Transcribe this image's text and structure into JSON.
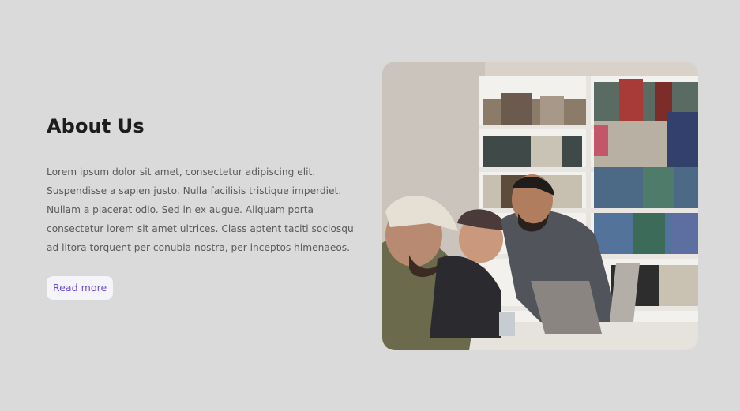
{
  "about": {
    "title": "About Us",
    "lines": [
      "Lorem ipsum dolor sit amet, consectetur adipiscing elit.",
      "Suspendisse a sapien justo. Nulla facilisis tristique imperdiet.",
      "Nullam a placerat odio. Sed in ex augue. Aliquam porta",
      "consectetur lorem sit amet ultrices. Class aptent taciti sociosqu",
      "ad litora torquent per conubia nostra, per inceptos himenaeos."
    ],
    "button_label": "Read more"
  },
  "image": {
    "icon": "students-library-photo"
  },
  "colors": {
    "background": "#dadada",
    "accent": "#6f4fd6",
    "button_bg": "#f6f4fb",
    "title": "#1d1d1d",
    "body_text": "#5a5a5a"
  }
}
